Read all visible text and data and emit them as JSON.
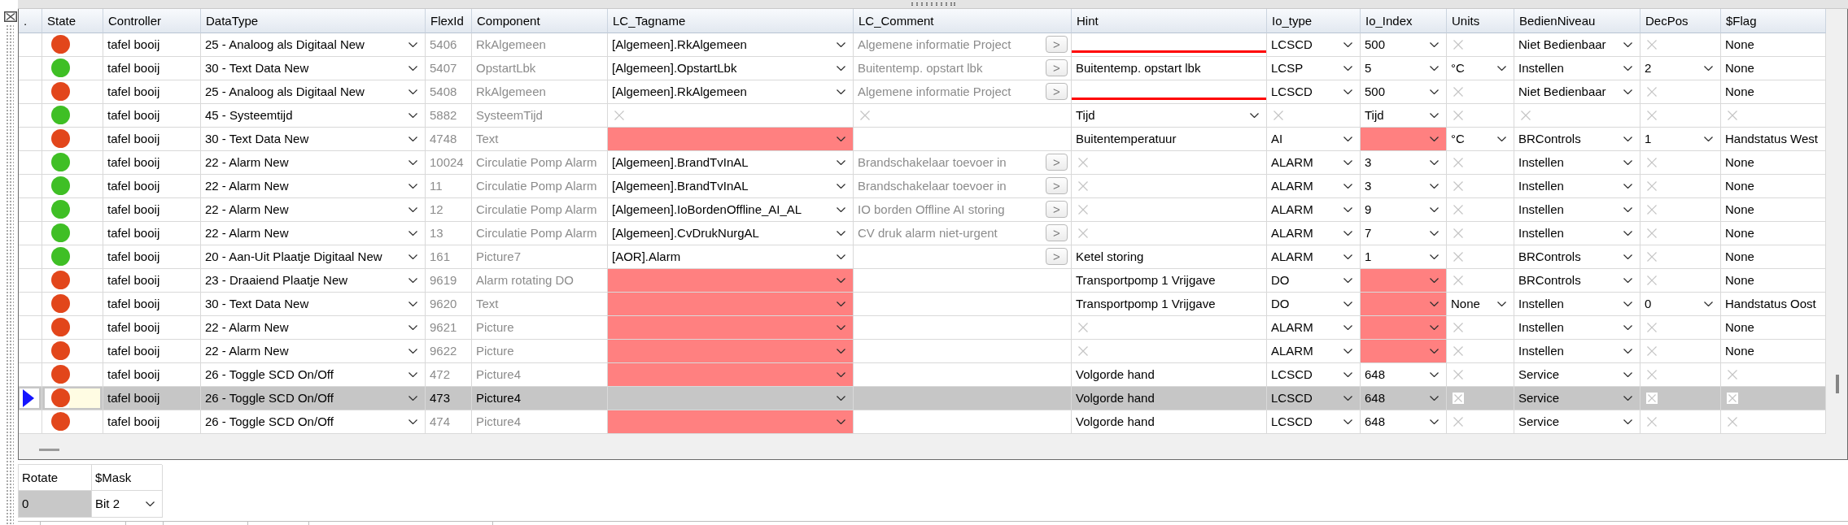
{
  "table": {
    "columns": [
      ".",
      "State",
      "Controller",
      "DataType",
      "FlexId",
      "Component",
      "LC_Tagname",
      "LC_Comment",
      "Hint",
      "Io_type",
      "Io_Index",
      "Units",
      "BedienNiveau",
      "DecPos",
      "$Flag"
    ],
    "rows": [
      {
        "selected": false,
        "cells": [
          {
            "kind": "selector"
          },
          {
            "kind": "status",
            "color": "#e2461b"
          },
          {
            "kind": "text",
            "text": "tafel booij"
          },
          {
            "kind": "dropdown",
            "text": "25 - Analoog als Digitaal New"
          },
          {
            "kind": "readonly",
            "text": "5406"
          },
          {
            "kind": "readonly",
            "text": "RkAlgemeen"
          },
          {
            "kind": "dropdown",
            "text": "[Algemeen].RkAlgemeen"
          },
          {
            "kind": "comment",
            "text": "Algemene informatie Project",
            "button": ">"
          },
          {
            "kind": "error"
          },
          {
            "kind": "dropdown",
            "text": "LCSCD"
          },
          {
            "kind": "dropdown",
            "text": "500"
          },
          {
            "kind": "na"
          },
          {
            "kind": "dropdown",
            "text": "Niet Bedienbaar"
          },
          {
            "kind": "na"
          },
          {
            "kind": "text",
            "text": "None"
          }
        ]
      },
      {
        "selected": false,
        "cells": [
          {
            "kind": "selector"
          },
          {
            "kind": "status",
            "color": "#3fbf25"
          },
          {
            "kind": "text",
            "text": "tafel booij"
          },
          {
            "kind": "dropdown",
            "text": "30 - Text Data New"
          },
          {
            "kind": "readonly",
            "text": "5407"
          },
          {
            "kind": "readonly",
            "text": "OpstartLbk"
          },
          {
            "kind": "dropdown",
            "text": "[Algemeen].OpstartLbk"
          },
          {
            "kind": "comment",
            "text": "Buitentemp. opstart lbk",
            "button": ">"
          },
          {
            "kind": "text",
            "text": "Buitentemp. opstart lbk"
          },
          {
            "kind": "dropdown",
            "text": "LCSP"
          },
          {
            "kind": "dropdown",
            "text": "5"
          },
          {
            "kind": "dropdown",
            "text": "°C"
          },
          {
            "kind": "dropdown",
            "text": "Instellen"
          },
          {
            "kind": "dropdown",
            "text": "2"
          },
          {
            "kind": "text",
            "text": "None"
          }
        ]
      },
      {
        "selected": false,
        "cells": [
          {
            "kind": "selector"
          },
          {
            "kind": "status",
            "color": "#e2461b"
          },
          {
            "kind": "text",
            "text": "tafel booij"
          },
          {
            "kind": "dropdown",
            "text": "25 - Analoog als Digitaal New"
          },
          {
            "kind": "readonly",
            "text": "5408"
          },
          {
            "kind": "readonly",
            "text": "RkAlgemeen"
          },
          {
            "kind": "dropdown",
            "text": "[Algemeen].RkAlgemeen"
          },
          {
            "kind": "comment",
            "text": "Algemene informatie Project",
            "button": ">"
          },
          {
            "kind": "error"
          },
          {
            "kind": "dropdown",
            "text": "LCSCD"
          },
          {
            "kind": "dropdown",
            "text": "500"
          },
          {
            "kind": "na"
          },
          {
            "kind": "dropdown",
            "text": "Niet Bedienbaar"
          },
          {
            "kind": "na"
          },
          {
            "kind": "text",
            "text": "None"
          }
        ]
      },
      {
        "selected": false,
        "cells": [
          {
            "kind": "selector"
          },
          {
            "kind": "status",
            "color": "#3fbf25"
          },
          {
            "kind": "text",
            "text": "tafel booij"
          },
          {
            "kind": "dropdown",
            "text": "45 - Systeemtijd"
          },
          {
            "kind": "readonly",
            "text": "5882"
          },
          {
            "kind": "readonly",
            "text": "SysteemTijd"
          },
          {
            "kind": "na"
          },
          {
            "kind": "na"
          },
          {
            "kind": "dropdown",
            "text": "Tijd"
          },
          {
            "kind": "na"
          },
          {
            "kind": "dropdown",
            "text": "Tijd"
          },
          {
            "kind": "na"
          },
          {
            "kind": "na"
          },
          {
            "kind": "na"
          },
          {
            "kind": "na"
          }
        ]
      },
      {
        "selected": false,
        "cells": [
          {
            "kind": "selector"
          },
          {
            "kind": "status",
            "color": "#e2461b"
          },
          {
            "kind": "text",
            "text": "tafel booij"
          },
          {
            "kind": "dropdown",
            "text": "30 - Text Data New"
          },
          {
            "kind": "readonly",
            "text": "4748"
          },
          {
            "kind": "readonly",
            "text": "Text"
          },
          {
            "kind": "missing"
          },
          {
            "kind": "blank"
          },
          {
            "kind": "text",
            "text": "Buitentemperatuur"
          },
          {
            "kind": "dropdown",
            "text": "AI"
          },
          {
            "kind": "missing"
          },
          {
            "kind": "dropdown",
            "text": "°C"
          },
          {
            "kind": "dropdown",
            "text": "BRControls"
          },
          {
            "kind": "dropdown",
            "text": "1"
          },
          {
            "kind": "text",
            "text": "Handstatus West"
          }
        ]
      },
      {
        "selected": false,
        "cells": [
          {
            "kind": "selector"
          },
          {
            "kind": "status",
            "color": "#3fbf25"
          },
          {
            "kind": "text",
            "text": "tafel booij"
          },
          {
            "kind": "dropdown",
            "text": "22 - Alarm New"
          },
          {
            "kind": "readonly",
            "text": "10024"
          },
          {
            "kind": "readonly",
            "text": "Circulatie Pomp Alarm"
          },
          {
            "kind": "dropdown",
            "text": "[Algemeen].BrandTvInAL"
          },
          {
            "kind": "comment",
            "text": "Brandschakelaar toevoer in",
            "button": ">"
          },
          {
            "kind": "na"
          },
          {
            "kind": "dropdown",
            "text": "ALARM"
          },
          {
            "kind": "dropdown",
            "text": "3"
          },
          {
            "kind": "na"
          },
          {
            "kind": "dropdown",
            "text": "Instellen"
          },
          {
            "kind": "na"
          },
          {
            "kind": "text",
            "text": "None"
          }
        ]
      },
      {
        "selected": false,
        "cells": [
          {
            "kind": "selector"
          },
          {
            "kind": "status",
            "color": "#3fbf25"
          },
          {
            "kind": "text",
            "text": "tafel booij"
          },
          {
            "kind": "dropdown",
            "text": "22 - Alarm New"
          },
          {
            "kind": "readonly",
            "text": "11"
          },
          {
            "kind": "readonly",
            "text": "Circulatie Pomp Alarm"
          },
          {
            "kind": "dropdown",
            "text": "[Algemeen].BrandTvInAL"
          },
          {
            "kind": "comment",
            "text": "Brandschakelaar toevoer in",
            "button": ">"
          },
          {
            "kind": "na"
          },
          {
            "kind": "dropdown",
            "text": "ALARM"
          },
          {
            "kind": "dropdown",
            "text": "3"
          },
          {
            "kind": "na"
          },
          {
            "kind": "dropdown",
            "text": "Instellen"
          },
          {
            "kind": "na"
          },
          {
            "kind": "text",
            "text": "None"
          }
        ]
      },
      {
        "selected": false,
        "cells": [
          {
            "kind": "selector"
          },
          {
            "kind": "status",
            "color": "#3fbf25"
          },
          {
            "kind": "text",
            "text": "tafel booij"
          },
          {
            "kind": "dropdown",
            "text": "22 - Alarm New"
          },
          {
            "kind": "readonly",
            "text": "12"
          },
          {
            "kind": "readonly",
            "text": "Circulatie Pomp Alarm"
          },
          {
            "kind": "dropdown",
            "text": "[Algemeen].IoBordenOffline_AI_AL"
          },
          {
            "kind": "comment",
            "text": "IO borden Offline AI storing",
            "button": ">"
          },
          {
            "kind": "na"
          },
          {
            "kind": "dropdown",
            "text": "ALARM"
          },
          {
            "kind": "dropdown",
            "text": "9"
          },
          {
            "kind": "na"
          },
          {
            "kind": "dropdown",
            "text": "Instellen"
          },
          {
            "kind": "na"
          },
          {
            "kind": "text",
            "text": "None"
          }
        ]
      },
      {
        "selected": false,
        "cells": [
          {
            "kind": "selector"
          },
          {
            "kind": "status",
            "color": "#3fbf25"
          },
          {
            "kind": "text",
            "text": "tafel booij"
          },
          {
            "kind": "dropdown",
            "text": "22 - Alarm New"
          },
          {
            "kind": "readonly",
            "text": "13"
          },
          {
            "kind": "readonly",
            "text": "Circulatie Pomp Alarm"
          },
          {
            "kind": "dropdown",
            "text": "[Algemeen].CvDrukNurgAL"
          },
          {
            "kind": "comment",
            "text": "CV druk alarm niet-urgent",
            "button": ">"
          },
          {
            "kind": "na"
          },
          {
            "kind": "dropdown",
            "text": "ALARM"
          },
          {
            "kind": "dropdown",
            "text": "7"
          },
          {
            "kind": "na"
          },
          {
            "kind": "dropdown",
            "text": "Instellen"
          },
          {
            "kind": "na"
          },
          {
            "kind": "text",
            "text": "None"
          }
        ]
      },
      {
        "selected": false,
        "cells": [
          {
            "kind": "selector"
          },
          {
            "kind": "status",
            "color": "#3fbf25"
          },
          {
            "kind": "text",
            "text": "tafel booij"
          },
          {
            "kind": "dropdown",
            "text": "20 - Aan-Uit Plaatje Digitaal New"
          },
          {
            "kind": "readonly",
            "text": "161"
          },
          {
            "kind": "readonly",
            "text": "Picture7"
          },
          {
            "kind": "dropdown",
            "text": "[AOR].Alarm"
          },
          {
            "kind": "comment",
            "button": ">"
          },
          {
            "kind": "text",
            "text": "Ketel storing"
          },
          {
            "kind": "dropdown",
            "text": "ALARM"
          },
          {
            "kind": "dropdown",
            "text": "1"
          },
          {
            "kind": "na"
          },
          {
            "kind": "dropdown",
            "text": "BRControls"
          },
          {
            "kind": "na"
          },
          {
            "kind": "text",
            "text": "None"
          }
        ]
      },
      {
        "selected": false,
        "cells": [
          {
            "kind": "selector"
          },
          {
            "kind": "status",
            "color": "#e2461b"
          },
          {
            "kind": "text",
            "text": "tafel booij"
          },
          {
            "kind": "dropdown",
            "text": "23 - Draaiend Plaatje New"
          },
          {
            "kind": "readonly",
            "text": "9619"
          },
          {
            "kind": "readonly",
            "text": "Alarm rotating DO"
          },
          {
            "kind": "missing"
          },
          {
            "kind": "blank"
          },
          {
            "kind": "text",
            "text": "Transportpomp 1 Vrijgave"
          },
          {
            "kind": "dropdown",
            "text": "DO"
          },
          {
            "kind": "missing"
          },
          {
            "kind": "na"
          },
          {
            "kind": "dropdown",
            "text": "BRControls"
          },
          {
            "kind": "na"
          },
          {
            "kind": "text",
            "text": "None"
          }
        ]
      },
      {
        "selected": false,
        "cells": [
          {
            "kind": "selector"
          },
          {
            "kind": "status",
            "color": "#e2461b"
          },
          {
            "kind": "text",
            "text": "tafel booij"
          },
          {
            "kind": "dropdown",
            "text": "30 - Text Data New"
          },
          {
            "kind": "readonly",
            "text": "9620"
          },
          {
            "kind": "readonly",
            "text": "Text"
          },
          {
            "kind": "missing"
          },
          {
            "kind": "blank"
          },
          {
            "kind": "text",
            "text": "Transportpomp 1 Vrijgave"
          },
          {
            "kind": "dropdown",
            "text": "DO"
          },
          {
            "kind": "missing"
          },
          {
            "kind": "dropdown",
            "text": "None"
          },
          {
            "kind": "dropdown",
            "text": "Instellen"
          },
          {
            "kind": "dropdown",
            "text": "0"
          },
          {
            "kind": "text",
            "text": "Handstatus Oost"
          }
        ]
      },
      {
        "selected": false,
        "cells": [
          {
            "kind": "selector"
          },
          {
            "kind": "status",
            "color": "#e2461b"
          },
          {
            "kind": "text",
            "text": "tafel booij"
          },
          {
            "kind": "dropdown",
            "text": "22 - Alarm New"
          },
          {
            "kind": "readonly",
            "text": "9621"
          },
          {
            "kind": "readonly",
            "text": "Picture"
          },
          {
            "kind": "missing"
          },
          {
            "kind": "blank"
          },
          {
            "kind": "na"
          },
          {
            "kind": "dropdown",
            "text": "ALARM"
          },
          {
            "kind": "missing"
          },
          {
            "kind": "na"
          },
          {
            "kind": "dropdown",
            "text": "Instellen"
          },
          {
            "kind": "na"
          },
          {
            "kind": "text",
            "text": "None"
          }
        ]
      },
      {
        "selected": false,
        "cells": [
          {
            "kind": "selector"
          },
          {
            "kind": "status",
            "color": "#e2461b"
          },
          {
            "kind": "text",
            "text": "tafel booij"
          },
          {
            "kind": "dropdown",
            "text": "22 - Alarm New"
          },
          {
            "kind": "readonly",
            "text": "9622"
          },
          {
            "kind": "readonly",
            "text": "Picture"
          },
          {
            "kind": "missing"
          },
          {
            "kind": "blank"
          },
          {
            "kind": "na"
          },
          {
            "kind": "dropdown",
            "text": "ALARM"
          },
          {
            "kind": "missing"
          },
          {
            "kind": "na"
          },
          {
            "kind": "dropdown",
            "text": "Instellen"
          },
          {
            "kind": "na"
          },
          {
            "kind": "text",
            "text": "None"
          }
        ]
      },
      {
        "selected": false,
        "cells": [
          {
            "kind": "selector"
          },
          {
            "kind": "status",
            "color": "#e2461b"
          },
          {
            "kind": "text",
            "text": "tafel booij"
          },
          {
            "kind": "dropdown",
            "text": "26 - Toggle SCD On/Off"
          },
          {
            "kind": "readonly",
            "text": "472"
          },
          {
            "kind": "readonly",
            "text": "Picture4"
          },
          {
            "kind": "missing"
          },
          {
            "kind": "blank"
          },
          {
            "kind": "text",
            "text": "Volgorde hand"
          },
          {
            "kind": "dropdown",
            "text": "LCSCD"
          },
          {
            "kind": "dropdown",
            "text": "648"
          },
          {
            "kind": "na"
          },
          {
            "kind": "dropdown",
            "text": "Service"
          },
          {
            "kind": "na"
          },
          {
            "kind": "na"
          }
        ]
      },
      {
        "selected": true,
        "cells": [
          {
            "kind": "selector"
          },
          {
            "kind": "status",
            "color": "#e2461b"
          },
          {
            "kind": "text",
            "text": "tafel booij"
          },
          {
            "kind": "dropdown",
            "text": "26 - Toggle SCD On/Off"
          },
          {
            "kind": "readonly",
            "text": "473"
          },
          {
            "kind": "readonly",
            "text": "Picture4"
          },
          {
            "kind": "missing"
          },
          {
            "kind": "blank"
          },
          {
            "kind": "text",
            "text": "Volgorde hand"
          },
          {
            "kind": "dropdown",
            "text": "LCSCD"
          },
          {
            "kind": "dropdown",
            "text": "648"
          },
          {
            "kind": "na"
          },
          {
            "kind": "dropdown",
            "text": "Service"
          },
          {
            "kind": "na"
          },
          {
            "kind": "na"
          }
        ]
      },
      {
        "selected": false,
        "cells": [
          {
            "kind": "selector"
          },
          {
            "kind": "status",
            "color": "#e2461b"
          },
          {
            "kind": "text",
            "text": "tafel booij"
          },
          {
            "kind": "dropdown",
            "text": "26 - Toggle SCD On/Off"
          },
          {
            "kind": "readonly",
            "text": "474"
          },
          {
            "kind": "readonly",
            "text": "Picture4"
          },
          {
            "kind": "missing"
          },
          {
            "kind": "blank"
          },
          {
            "kind": "text",
            "text": "Volgorde hand"
          },
          {
            "kind": "dropdown",
            "text": "LCSCD"
          },
          {
            "kind": "dropdown",
            "text": "648"
          },
          {
            "kind": "na"
          },
          {
            "kind": "dropdown",
            "text": "Service"
          },
          {
            "kind": "na"
          },
          {
            "kind": "na"
          }
        ]
      }
    ]
  },
  "properties": {
    "columns": [
      "Rotate",
      "$Mask"
    ],
    "cells": [
      {
        "kind": "text",
        "text": "0",
        "selected": true
      },
      {
        "kind": "dropdown",
        "text": "Bit 2",
        "selected": false
      }
    ]
  }
}
